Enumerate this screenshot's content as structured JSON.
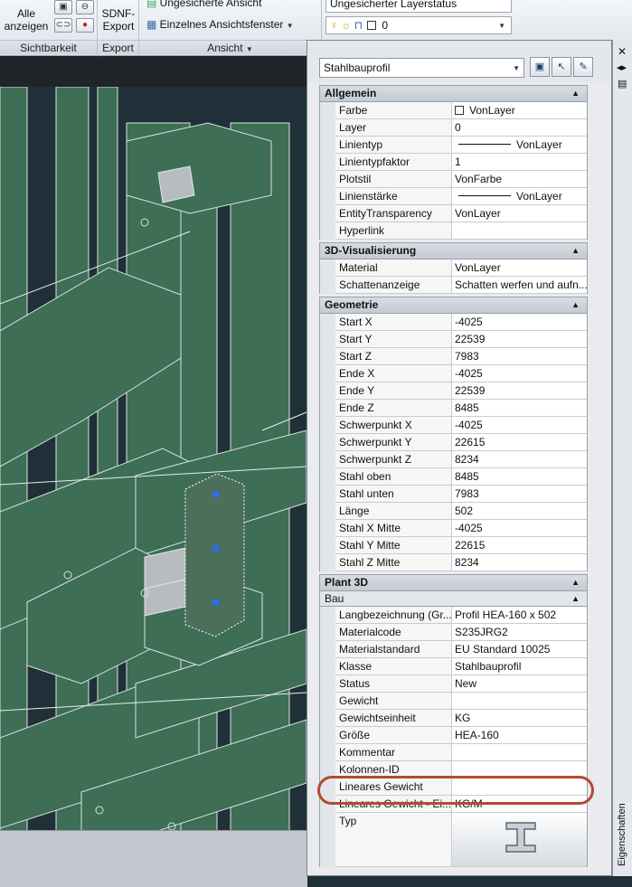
{
  "ribbon": {
    "sichtbarkeit": {
      "show_all_label_1": "Alle",
      "show_all_label_2": "anzeigen",
      "group_label": "Sichtbarkeit"
    },
    "export": {
      "label_1": "SDNF-",
      "label_2": "Export",
      "group_label": "Export"
    },
    "ansicht": {
      "unsaved_view": "Ungesicherte Ansicht",
      "single_viewport": "Einzelnes Ansichtsfenster",
      "group_label": "Ansicht"
    },
    "layer": {
      "layer_status": "Ungesicherter Layerstatus",
      "layer_value": "0"
    }
  },
  "palette": {
    "type_selector": "Stahlbauprofil",
    "side_title": "Eigenschaften",
    "categories": [
      {
        "title": "Allgemein",
        "rows": [
          {
            "name": "Farbe",
            "value": "VonLayer",
            "swatch": "color"
          },
          {
            "name": "Layer",
            "value": "0"
          },
          {
            "name": "Linientyp",
            "value": "VonLayer",
            "swatch": "line"
          },
          {
            "name": "Linientypfaktor",
            "value": "1"
          },
          {
            "name": "Plotstil",
            "value": "VonFarbe"
          },
          {
            "name": "Linienstärke",
            "value": "VonLayer",
            "swatch": "line"
          },
          {
            "name": "EntityTransparency",
            "value": "VonLayer"
          },
          {
            "name": "Hyperlink",
            "value": ""
          }
        ]
      },
      {
        "title": "3D-Visualisierung",
        "rows": [
          {
            "name": "Material",
            "value": "VonLayer"
          },
          {
            "name": "Schattenanzeige",
            "value": "Schatten werfen und aufn..."
          }
        ]
      },
      {
        "title": "Geometrie",
        "rows": [
          {
            "name": "Start X",
            "value": "-4025"
          },
          {
            "name": "Start Y",
            "value": "22539"
          },
          {
            "name": "Start Z",
            "value": "7983"
          },
          {
            "name": "Ende X",
            "value": "-4025"
          },
          {
            "name": "Ende Y",
            "value": "22539"
          },
          {
            "name": "Ende Z",
            "value": "8485"
          },
          {
            "name": "Schwerpunkt X",
            "value": "-4025"
          },
          {
            "name": "Schwerpunkt Y",
            "value": "22615"
          },
          {
            "name": "Schwerpunkt Z",
            "value": "8234"
          },
          {
            "name": "Stahl oben",
            "value": "8485"
          },
          {
            "name": "Stahl unten",
            "value": "7983"
          },
          {
            "name": "Länge",
            "value": "502"
          },
          {
            "name": "Stahl X Mitte",
            "value": "-4025"
          },
          {
            "name": "Stahl Y Mitte",
            "value": "22615"
          },
          {
            "name": "Stahl Z Mitte",
            "value": "8234"
          }
        ]
      },
      {
        "title": "Plant 3D",
        "subcategory": "Bau",
        "rows": [
          {
            "name": "Langbezeichnung (Gr...",
            "value": "Profil HEA-160 x 502"
          },
          {
            "name": "Materialcode",
            "value": "S235JRG2"
          },
          {
            "name": "Materialstandard",
            "value": "EU Standard 10025"
          },
          {
            "name": "Klasse",
            "value": "Stahlbauprofil"
          },
          {
            "name": "Status",
            "value": "New"
          },
          {
            "name": "Gewicht",
            "value": ""
          },
          {
            "name": "Gewichtseinheit",
            "value": "KG"
          },
          {
            "name": "Größe",
            "value": "HEA-160"
          },
          {
            "name": "Kommentar",
            "value": ""
          },
          {
            "name": "Kolonnen-ID",
            "value": ""
          },
          {
            "name": "Lineares Gewicht",
            "value": ""
          },
          {
            "name": "Lineares Gewicht - Ei...",
            "value": "KG/M"
          },
          {
            "name": "Typ",
            "value": "",
            "icon": "i-beam-icon"
          }
        ]
      }
    ]
  },
  "colors": {
    "steel": "#3e6e55",
    "highlight_ring": "#b14b33"
  }
}
